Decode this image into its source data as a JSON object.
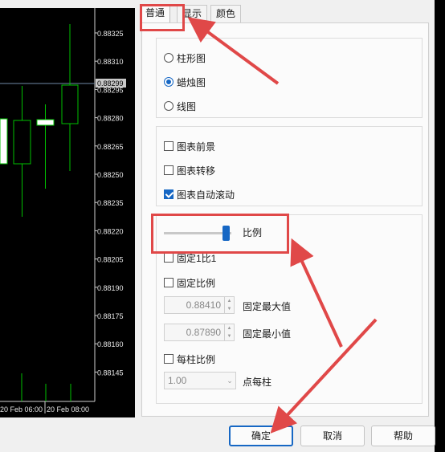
{
  "chart": {
    "price_labels": [
      "0.88325",
      "0.88310",
      "0.88295",
      "0.88280",
      "0.88265",
      "0.88250",
      "0.88235",
      "0.88220",
      "0.88205",
      "0.88190",
      "0.88175",
      "0.88160",
      "0.88145"
    ],
    "current_price": "0.88299",
    "time_labels": [
      "20 Feb 06:00",
      "20 Feb 08:00"
    ]
  },
  "tabs": [
    "普通",
    "显示",
    "颜色"
  ],
  "chart_type": {
    "options": [
      "柱形图",
      "蜡烛图",
      "线图"
    ],
    "selected": 1
  },
  "chart_options": [
    {
      "label": "图表前景",
      "checked": false
    },
    {
      "label": "图表转移",
      "checked": false
    },
    {
      "label": "图表自动滚动",
      "checked": true
    }
  ],
  "scale": {
    "label": "比例",
    "slider_fraction": 0.95,
    "fixed_1to1_label": "固定1比1",
    "fixed_scale_label": "固定比例",
    "fixed_max_value": "0.88410",
    "fixed_max_label": "固定最大值",
    "fixed_min_value": "0.87890",
    "fixed_min_label": "固定最小值",
    "per_bar_label": "每柱比例",
    "points_per_bar_value": "1.00",
    "points_per_bar_label": "点每柱"
  },
  "buttons": {
    "ok": "确定",
    "cancel": "取消",
    "help": "帮助"
  },
  "colors": {
    "accent": "#1667c4",
    "annotation": "#e04848",
    "candle": "#00c000"
  }
}
